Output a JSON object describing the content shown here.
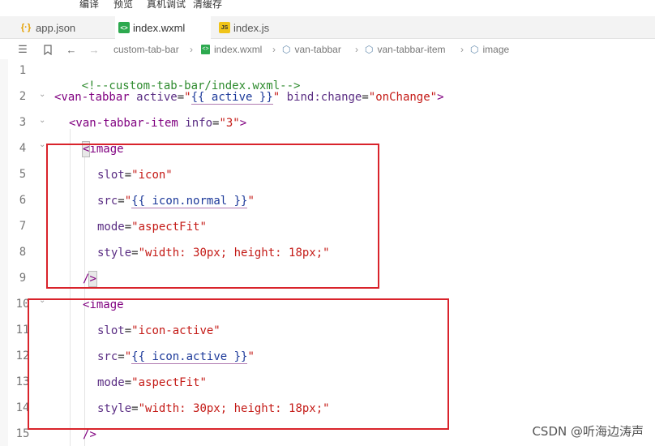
{
  "menu": {
    "items": [
      "编译",
      "预览",
      "真机调试",
      "清缓存"
    ]
  },
  "tabs": [
    {
      "label": "app.json",
      "icon": "json-file-icon",
      "active": false
    },
    {
      "label": "index.wxml",
      "icon": "wxml-file-icon",
      "active": true
    },
    {
      "label": "index.js",
      "icon": "js-file-icon",
      "active": false
    }
  ],
  "toolbar": {
    "list_icon": "list-icon",
    "bookmark_icon": "bookmark-icon",
    "back_icon": "arrow-left-icon",
    "forward_icon": "arrow-right-icon"
  },
  "breadcrumb": [
    "custom-tab-bar",
    "index.wxml",
    "van-tabbar",
    "van-tabbar-item",
    "image"
  ],
  "editor": {
    "line_numbers": [
      "1",
      "2",
      "3",
      "4",
      "5",
      "6",
      "7",
      "8",
      "9",
      "10",
      "11",
      "12",
      "13",
      "14",
      "15"
    ],
    "lines": {
      "l1": "<!--custom-tab-bar/index.wxml-->",
      "l2_open": "<van-tabbar",
      "l2_attr1": "active",
      "l2_val1_q1": "\"",
      "l2_val1_expr": "{{ active }}",
      "l2_val1_q2": "\"",
      "l2_attr2": "bind:change",
      "l2_val2": "\"onChange\"",
      "l2_close": ">",
      "l3_open": "<van-tabbar-item",
      "l3_attr": "info",
      "l3_val": "\"3\"",
      "l3_close": ">",
      "img_open": "image",
      "slot_attr": "slot",
      "slot1_val": "\"icon\"",
      "slot2_val": "\"icon-active\"",
      "src_attr": "src",
      "src1_expr": "{{ icon.normal }}",
      "src2_expr": "{{ icon.active }}",
      "mode_attr": "mode",
      "mode_val": "\"aspectFit\"",
      "style_attr": "style",
      "style_val": "\"width: 30px; height: 18px;\"",
      "self_close_slash": "/",
      "self_close_gt": ">",
      "lt": "<",
      "eq": "=",
      "quote": "\""
    }
  },
  "watermark": "CSDN @听海边涛声",
  "colors": {
    "highlight_box": "#d9232b",
    "tag": "#800080",
    "string": "#c41a16",
    "comment": "#2e8b2e"
  }
}
